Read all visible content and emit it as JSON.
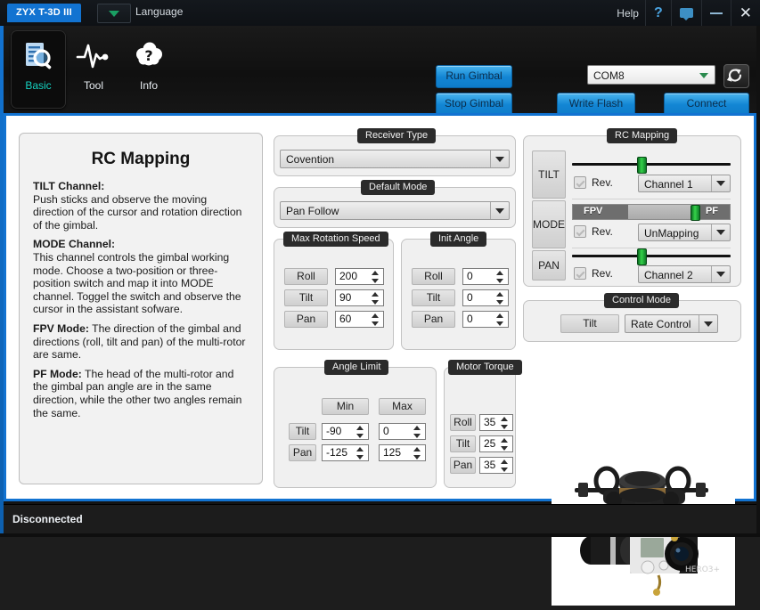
{
  "window": {
    "app_tab": "ZYX T-3D III",
    "language_label": "Language",
    "help_label": "Help",
    "help_icon": "question-mark-icon",
    "message_icon": "message-icon",
    "minimize_icon": "minimize-icon",
    "close_icon": "close-icon",
    "accent_blue": "#1273d1"
  },
  "nav": {
    "tabs": [
      {
        "label": "Basic",
        "icon": "document-search-icon",
        "active": true
      },
      {
        "label": "Tool",
        "icon": "waveform-icon",
        "active": false
      },
      {
        "label": "Info",
        "icon": "cloud-question-icon",
        "active": false
      }
    ]
  },
  "toolbar": {
    "run_gimbal": "Run Gimbal",
    "stop_gimbal": "Stop Gimbal",
    "write_flash": "Write Flash",
    "connect": "Connect",
    "com_port": "COM8",
    "refresh_icon": "refresh-icon"
  },
  "help_panel": {
    "title": "RC Mapping",
    "sections": [
      {
        "heading": "TILT Channel:",
        "body": "Push sticks and observe the moving direction of the cursor and rotation direction of the gimbal."
      },
      {
        "heading": "MODE Channel:",
        "body": "This channel controls the gimbal working mode. Choose a two-position or three-position switch and map it into MODE channel. Toggel the switch and observe the cursor in the assistant sofware."
      },
      {
        "heading": "FPV Mode:",
        "body": " The direction of the gimbal and directions (roll, tilt and pan) of the multi-rotor are same."
      },
      {
        "heading": "PF Mode:",
        "body": " The head of the multi-rotor and the gimbal pan angle are in the same direction, while the other two angles remain the same."
      }
    ]
  },
  "receiver_type": {
    "title": "Receiver Type",
    "value": "Covention"
  },
  "default_mode": {
    "title": "Default Mode",
    "value": "Pan Follow"
  },
  "max_rotation_speed": {
    "title": "Max Rotation Speed",
    "rows": [
      {
        "label": "Roll",
        "value": "200"
      },
      {
        "label": "Tilt",
        "value": "90"
      },
      {
        "label": "Pan",
        "value": "60"
      }
    ]
  },
  "init_angle": {
    "title": "Init Angle",
    "rows": [
      {
        "label": "Roll",
        "value": "0"
      },
      {
        "label": "Tilt",
        "value": "0"
      },
      {
        "label": "Pan",
        "value": "0"
      }
    ]
  },
  "angle_limit": {
    "title": "Angle Limit",
    "col_min": "Min",
    "col_max": "Max",
    "rows": [
      {
        "label": "Tilt",
        "min": "-90",
        "max": "0"
      },
      {
        "label": "Pan",
        "min": "-125",
        "max": "125"
      }
    ]
  },
  "motor_torque": {
    "title": "Motor Torque",
    "rows": [
      {
        "label": "Roll",
        "value": "35"
      },
      {
        "label": "Tilt",
        "value": "25"
      },
      {
        "label": "Pan",
        "value": "35"
      }
    ]
  },
  "rc_mapping": {
    "title": "RC Mapping",
    "rev_label_tilt": "Rev.",
    "rev_label_mode": "Rev.",
    "rev_label_pan": "Rev.",
    "tilt": {
      "label": "TILT",
      "channel": "Channel 1",
      "slider_percent": 48
    },
    "mode": {
      "label": "MODE",
      "channel": "UnMapping",
      "fpv_label": "FPV",
      "pf_label": "PF",
      "slider_percent": 76
    },
    "pan": {
      "label": "PAN",
      "channel": "Channel 2",
      "slider_percent": 48
    },
    "slider_color": "#2ec73f"
  },
  "control_mode": {
    "title": "Control Mode",
    "axis_label": "Tilt",
    "value": "Rate Control"
  },
  "gimbal_image": {
    "alt": "three-axis-gimbal-with-gopro-camera",
    "camera_text": "HERO3+"
  },
  "statusbar": {
    "text": "Disconnected"
  }
}
